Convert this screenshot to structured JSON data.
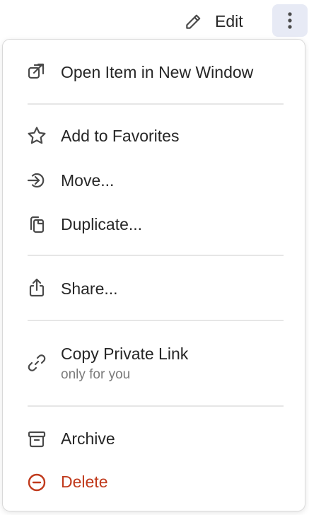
{
  "toolbar": {
    "edit_label": "Edit"
  },
  "menu": {
    "open_new_window": "Open Item in New Window",
    "add_favorites": "Add to Favorites",
    "move": "Move...",
    "duplicate": "Duplicate...",
    "share": "Share...",
    "copy_private_link": "Copy Private Link",
    "copy_private_link_note": "only for you",
    "archive": "Archive",
    "delete": "Delete"
  },
  "colors": {
    "danger": "#c0391b",
    "icon": "#4a4a4a",
    "more_button_bg": "#e7eaf5"
  },
  "icons": {
    "edit": "pencil-icon",
    "more": "vertical-dots-icon",
    "open_new_window": "external-link-icon",
    "add_favorites": "star-icon",
    "move": "arrow-into-circle-icon",
    "duplicate": "copy-icon",
    "share": "share-upload-icon",
    "copy_private_link": "link-icon",
    "archive": "archive-box-icon",
    "delete": "minus-circle-icon"
  }
}
